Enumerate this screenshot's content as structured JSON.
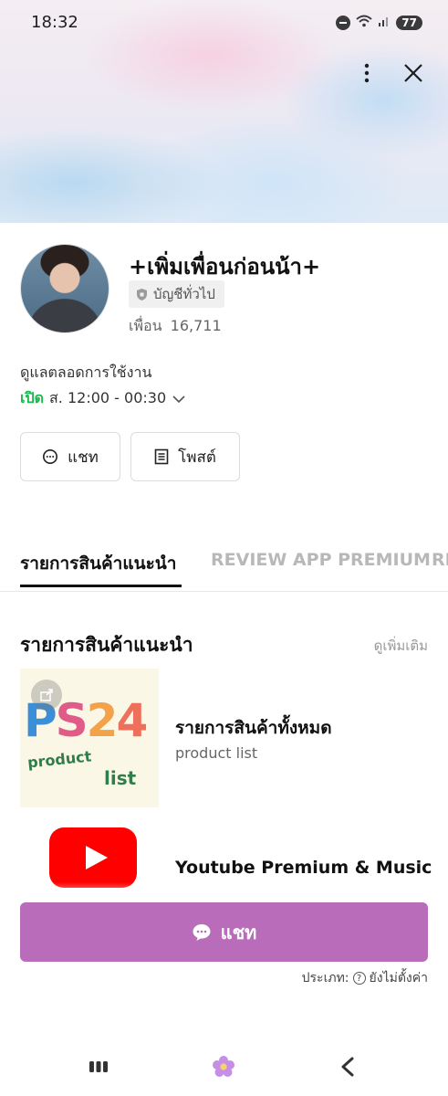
{
  "status_bar": {
    "time": "18:32",
    "battery": "77"
  },
  "account": {
    "name": "+เพิ่มเพื่อนก่อนน้า+",
    "type_badge": "บัญชีทั่วไป",
    "friends_label": "เพื่อน",
    "friends_count": "16,711"
  },
  "hours": {
    "title": "ดูแลตลอดการใช้งาน",
    "status": "เปิด",
    "time": "ส. 12:00 - 00:30"
  },
  "actions": {
    "chat_label": "แชท",
    "post_label": "โพสต์"
  },
  "tabs": [
    {
      "label": "รายการสินค้าแนะนำ"
    },
    {
      "label": "REVIEW APP PREMIUM"
    },
    {
      "label": "RE"
    }
  ],
  "section": {
    "title": "รายการสินค้าแนะนำ",
    "more": "ดูเพิ่มเติม"
  },
  "products": [
    {
      "name": "รายการสินค้าทั้งหมด",
      "subtitle": "product list",
      "image_text": {
        "p": "P",
        "s": "S",
        "n2": "2",
        "n4": "4",
        "product": "product",
        "list": "list"
      }
    },
    {
      "name": "Youtube Premium & Music"
    }
  ],
  "chat_button": {
    "label": "แชท"
  },
  "type_line": {
    "label": "ประเภท:",
    "value": "ยังไม่ตั้งค่า"
  },
  "colors": {
    "accent": "#b86cba",
    "open_green": "#1bb84c"
  }
}
